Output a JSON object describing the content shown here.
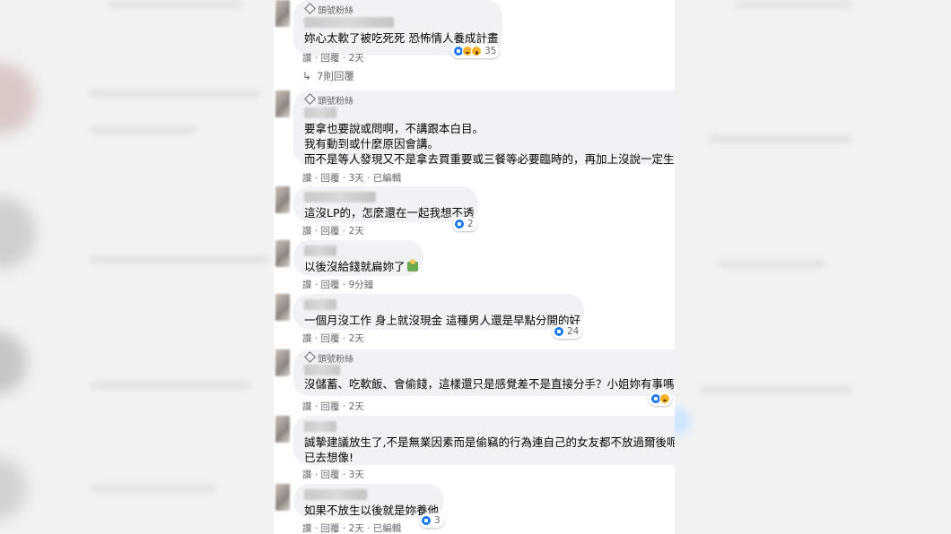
{
  "comments": [
    {
      "badge": "頭號粉絲",
      "text_lines": [
        "妳心太軟了被吃死死 恐怖情人養成計畫"
      ],
      "reactions": {
        "icons": [
          "like-icon",
          "haha-icon",
          "wow-icon"
        ],
        "count": "35"
      },
      "actions": {
        "like": "讚",
        "sep1": "·",
        "reply": "回覆",
        "sep2": "·",
        "time": "2天"
      },
      "replies_link": "7則回覆"
    },
    {
      "badge": "頭號粉絲",
      "text_lines": [
        "要拿也要說或問啊，不講跟本白目。",
        "我有動到或什麼原因會講。",
        "而不是等人發現又不是拿去買重要或三餐等必要臨時的，再加上沒說一定生氣"
      ],
      "actions": {
        "like": "讚",
        "sep1": "·",
        "reply": "回覆",
        "sep2": "·",
        "time": "3天",
        "sep3": "·",
        "edited": "已編輯"
      }
    },
    {
      "text_lines": [
        "這沒LP的，怎麼還在一起我想不透"
      ],
      "reactions": {
        "icons": [
          "like-icon"
        ],
        "count": "2"
      },
      "actions": {
        "like": "讚",
        "sep1": "·",
        "reply": "回覆",
        "sep2": "·",
        "time": "2天"
      }
    },
    {
      "text_lines": [
        "以後沒給錢就扁妳了"
      ],
      "actions": {
        "like": "讚",
        "sep1": "·",
        "reply": "回覆",
        "sep2": "·",
        "time": "9分鐘"
      }
    },
    {
      "text_lines": [
        "一個月沒工作 身上就沒現金 這種男人還是早點分開的好"
      ],
      "reactions": {
        "icons": [
          "like-icon"
        ],
        "count": "24"
      },
      "actions": {
        "like": "讚",
        "sep1": "·",
        "reply": "回覆",
        "sep2": "·",
        "time": "2天"
      }
    },
    {
      "badge": "頭號粉絲",
      "text_lines": [
        "沒儲蓄、吃軟飯、會偷錢，這樣還只是感覺差不是直接分手？小姐妳有事嗎"
      ],
      "reactions": {
        "icons": [
          "like-icon",
          "haha-icon"
        ],
        "count": ""
      },
      "actions": {
        "like": "讚",
        "sep1": "·",
        "reply": "回覆",
        "sep2": "·",
        "time": "2天"
      }
    },
    {
      "text_lines": [
        "誠摯建議放生了,不是無業因素而是偷竊的行為連自己的女友都不放過爾後呢你",
        "已去想像!"
      ],
      "actions": {
        "like": "讚",
        "sep1": "·",
        "reply": "回覆",
        "sep2": "·",
        "time": "3天"
      }
    },
    {
      "text_lines": [
        "如果不放生以後就是妳養他"
      ],
      "reactions": {
        "icons": [
          "like-icon"
        ],
        "count": "3"
      },
      "actions": {
        "like": "讚",
        "sep1": "·",
        "reply": "回覆",
        "sep2": "·",
        "time": "2天",
        "sep3": "·",
        "edited": "已編輯"
      }
    }
  ]
}
